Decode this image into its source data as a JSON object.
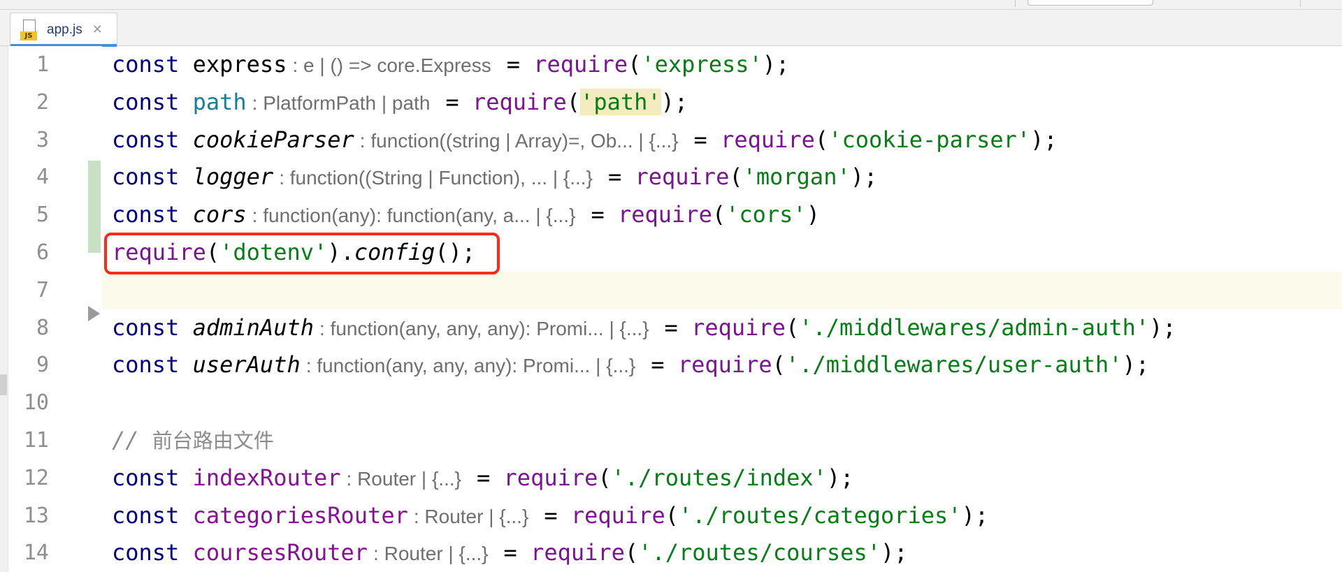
{
  "tabs": [
    {
      "label": "app.js",
      "icon": "js-file-icon",
      "badge": "JS",
      "close": "✕",
      "active": true
    }
  ],
  "editor": {
    "lines": [
      {
        "n": "1",
        "tokens": [
          {
            "t": "const ",
            "c": "kw"
          },
          {
            "t": "express",
            "c": "var"
          },
          {
            "t": ": e | () => core.Express",
            "c": "hint"
          },
          {
            "t": "= ",
            "c": "var"
          },
          {
            "t": "require",
            "c": "fn"
          },
          {
            "t": "(",
            "c": "var"
          },
          {
            "t": "'express'",
            "c": "str"
          },
          {
            "t": ");",
            "c": "var"
          }
        ]
      },
      {
        "n": "2",
        "tokens": [
          {
            "t": "const ",
            "c": "kw"
          },
          {
            "t": "path",
            "c": "var-teal"
          },
          {
            "t": ": PlatformPath | path",
            "c": "hint"
          },
          {
            "t": "= ",
            "c": "var"
          },
          {
            "t": "require",
            "c": "fn"
          },
          {
            "t": "(",
            "c": "var"
          },
          {
            "t": "'path'",
            "c": "str str-hl"
          },
          {
            "t": ");",
            "c": "var"
          }
        ]
      },
      {
        "n": "3",
        "tokens": [
          {
            "t": "const ",
            "c": "kw"
          },
          {
            "t": "cookieParser",
            "c": "var-it"
          },
          {
            "t": ": function((string | Array)=, Ob... | {...}",
            "c": "hint"
          },
          {
            "t": "= ",
            "c": "var"
          },
          {
            "t": "require",
            "c": "fn"
          },
          {
            "t": "(",
            "c": "var"
          },
          {
            "t": "'cookie-parser'",
            "c": "str"
          },
          {
            "t": ");",
            "c": "var"
          }
        ]
      },
      {
        "n": "4",
        "tokens": [
          {
            "t": "const ",
            "c": "kw"
          },
          {
            "t": "logger",
            "c": "var-it"
          },
          {
            "t": ": function((String | Function), ... | {...}",
            "c": "hint"
          },
          {
            "t": "= ",
            "c": "var"
          },
          {
            "t": "require",
            "c": "fn"
          },
          {
            "t": "(",
            "c": "var"
          },
          {
            "t": "'morgan'",
            "c": "str"
          },
          {
            "t": ");",
            "c": "var"
          }
        ]
      },
      {
        "n": "5",
        "tokens": [
          {
            "t": "const ",
            "c": "kw"
          },
          {
            "t": "cors",
            "c": "var-it"
          },
          {
            "t": ": function(any): function(any, a... | {...}",
            "c": "hint"
          },
          {
            "t": "= ",
            "c": "var"
          },
          {
            "t": "require",
            "c": "fn"
          },
          {
            "t": "(",
            "c": "var"
          },
          {
            "t": "'cors'",
            "c": "str"
          },
          {
            "t": ")",
            "c": "var"
          }
        ]
      },
      {
        "n": "6",
        "tokens": [
          {
            "t": "require",
            "c": "fn"
          },
          {
            "t": "(",
            "c": "var"
          },
          {
            "t": "'dotenv'",
            "c": "str"
          },
          {
            "t": ").",
            "c": "var"
          },
          {
            "t": "config",
            "c": "method"
          },
          {
            "t": "();",
            "c": "var"
          }
        ]
      },
      {
        "n": "7",
        "tokens": []
      },
      {
        "n": "8",
        "tokens": [
          {
            "t": "const ",
            "c": "kw"
          },
          {
            "t": "adminAuth",
            "c": "var-it"
          },
          {
            "t": ": function(any, any, any): Promi... | {...}",
            "c": "hint"
          },
          {
            "t": "= ",
            "c": "var"
          },
          {
            "t": "require",
            "c": "fn"
          },
          {
            "t": "(",
            "c": "var"
          },
          {
            "t": "'./middlewares/admin-auth'",
            "c": "str"
          },
          {
            "t": ");",
            "c": "var"
          }
        ]
      },
      {
        "n": "9",
        "tokens": [
          {
            "t": "const ",
            "c": "kw"
          },
          {
            "t": "userAuth",
            "c": "var-it"
          },
          {
            "t": ": function(any, any, any): Promi... | {...}",
            "c": "hint"
          },
          {
            "t": "= ",
            "c": "var"
          },
          {
            "t": "require",
            "c": "fn"
          },
          {
            "t": "(",
            "c": "var"
          },
          {
            "t": "'./middlewares/user-auth'",
            "c": "str"
          },
          {
            "t": ");",
            "c": "var"
          }
        ]
      },
      {
        "n": "10",
        "tokens": []
      },
      {
        "n": "11",
        "tokens": [
          {
            "t": "// ",
            "c": "comment"
          },
          {
            "t": "前台路由文件",
            "c": "comment comment-cn"
          }
        ]
      },
      {
        "n": "12",
        "tokens": [
          {
            "t": "const ",
            "c": "kw"
          },
          {
            "t": "indexRouter",
            "c": "var-purple"
          },
          {
            "t": ": Router | {...}",
            "c": "hint"
          },
          {
            "t": "= ",
            "c": "var"
          },
          {
            "t": "require",
            "c": "fn"
          },
          {
            "t": "(",
            "c": "var"
          },
          {
            "t": "'./routes/index'",
            "c": "str"
          },
          {
            "t": ");",
            "c": "var"
          }
        ]
      },
      {
        "n": "13",
        "tokens": [
          {
            "t": "const ",
            "c": "kw"
          },
          {
            "t": "categoriesRouter",
            "c": "var-purple"
          },
          {
            "t": ": Router | {...}",
            "c": "hint"
          },
          {
            "t": "= ",
            "c": "var"
          },
          {
            "t": "require",
            "c": "fn"
          },
          {
            "t": "(",
            "c": "var"
          },
          {
            "t": "'./routes/categories'",
            "c": "str"
          },
          {
            "t": ");",
            "c": "var"
          }
        ]
      },
      {
        "n": "14",
        "tokens": [
          {
            "t": "const ",
            "c": "kw"
          },
          {
            "t": "coursesRouter",
            "c": "var-purple"
          },
          {
            "t": ": Router | {...}",
            "c": "hint"
          },
          {
            "t": "= ",
            "c": "var"
          },
          {
            "t": "require",
            "c": "fn"
          },
          {
            "t": "(",
            "c": "var"
          },
          {
            "t": "'./routes/courses'",
            "c": "str"
          },
          {
            "t": ");",
            "c": "var"
          }
        ]
      }
    ],
    "annotation_color": "#ff2a1a",
    "annotated_line": 6
  }
}
